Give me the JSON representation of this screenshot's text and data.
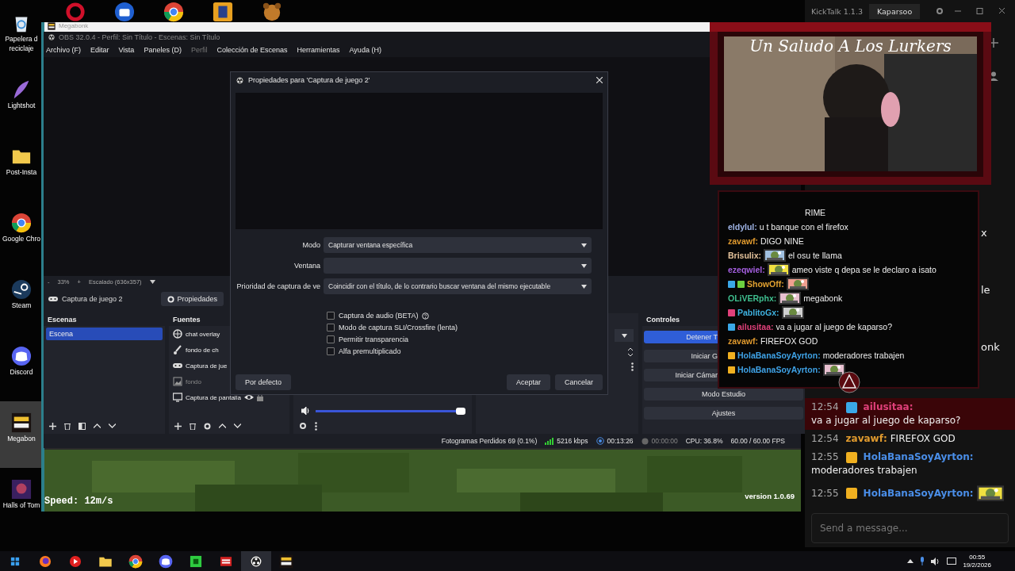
{
  "desktop": {
    "top_icons": [
      {
        "kind": "ring"
      },
      {
        "kind": "camera"
      },
      {
        "kind": "browser"
      },
      {
        "kind": "game"
      },
      {
        "kind": "bear"
      }
    ],
    "icons": [
      {
        "kind": "recycle",
        "lines": [
          "Papelera d",
          "reciclaje"
        ],
        "selected": false
      },
      {
        "kind": "feather",
        "lines": [
          "Lightshot"
        ],
        "selected": false
      },
      {
        "kind": "folder",
        "lines": [
          "Post-Insta"
        ],
        "selected": false
      },
      {
        "kind": "browser",
        "lines": [
          "Google Chro"
        ],
        "selected": false
      },
      {
        "kind": "steam",
        "lines": [
          "Steam"
        ],
        "selected": false
      },
      {
        "kind": "chat",
        "lines": [
          "Discord"
        ],
        "selected": false
      },
      {
        "kind": "megabonk",
        "lines": [
          "Megabon"
        ],
        "selected": true
      },
      {
        "kind": "halls",
        "lines": [
          "Halls of Tom"
        ],
        "selected": false
      }
    ]
  },
  "game_window": {
    "title": "Megabonk",
    "speed": "Speed: 12m/s",
    "version": "version 1.0.69"
  },
  "obs": {
    "title": "OBS 32.0.4 - Perfil: Sin Título - Escenas: Sin Título",
    "menu": [
      {
        "label": "Archivo (F)",
        "disabled": false
      },
      {
        "label": "Editar",
        "disabled": false
      },
      {
        "label": "Vista",
        "disabled": false
      },
      {
        "label": "Paneles (D)",
        "disabled": false
      },
      {
        "label": "Perfil",
        "disabled": true
      },
      {
        "label": "Colección de Escenas",
        "disabled": false
      },
      {
        "label": "Herramientas",
        "disabled": false
      },
      {
        "label": "Ayuda (H)",
        "disabled": false
      }
    ],
    "zoom": {
      "minus": "-",
      "percent": "33%",
      "plus": "+",
      "scale": "Escalado (636x357)"
    },
    "source_bar": {
      "source": "Captura de juego 2",
      "properties": "Propiedades"
    },
    "scenes": {
      "title": "Escenas",
      "items": [
        {
          "label": "Escena",
          "selected": true
        }
      ]
    },
    "sources": {
      "title": "Fuentes",
      "items": [
        {
          "kind": "browser",
          "label": "chat overlay",
          "visible": true,
          "hovered": false
        },
        {
          "kind": "brush",
          "label": "fondo de ch",
          "visible": true,
          "hovered": false
        },
        {
          "kind": "game",
          "label": "Captura de jue",
          "visible": true,
          "hovered": false
        },
        {
          "label": "fondo",
          "visible": false,
          "hovered": false
        },
        {
          "kind": "display",
          "label": "Captura de pantalla",
          "visible": true,
          "hovered": true
        }
      ]
    },
    "mixer": {
      "level": 1
    },
    "controls": {
      "title": "Controles",
      "buttons": [
        {
          "label": "Detener T",
          "kind": "cut",
          "active": true
        },
        {
          "label": "Iniciar G",
          "kind": "cut",
          "active": false
        },
        {
          "label": "Iniciar Cámar",
          "kind": "cut",
          "active": false
        },
        {
          "label": "Modo Estudio",
          "kind": "full",
          "active": false
        },
        {
          "label": "Ajustes",
          "kind": "full",
          "active": false
        }
      ]
    },
    "status": {
      "dropped": "Fotogramas Perdidos 69 (0.1%)",
      "bitrate": "5216 kbps",
      "stream_time": "00:13:26",
      "rec_time": "00:00:00",
      "cpu": "CPU: 36.8%",
      "fps": "60.00 / 60.00 FPS"
    }
  },
  "dialog": {
    "title": "Propiedades para 'Captura de juego 2'",
    "fields": [
      {
        "label": "Modo",
        "value": "Capturar ventana específica"
      },
      {
        "label": "Ventana"
      },
      {
        "label": "Prioridad de captura de ve",
        "value": "Coincidir con el título, de lo contrario buscar ventana del mismo ejecutable"
      }
    ],
    "checks": [
      {
        "label": "Captura de audio (BETA)",
        "checked": false,
        "help": true
      },
      {
        "label": "Modo de captura SLI/Crossfire (lenta)",
        "checked": false,
        "help": false
      },
      {
        "label": "Permitir transparencia",
        "checked": false,
        "help": false
      },
      {
        "label": "Alfa premultiplicado",
        "checked": false,
        "help": false
      }
    ],
    "defaults": "Por defecto",
    "ok": "Aceptar",
    "cancel": "Cancelar"
  },
  "webcam": {
    "caption": "Un Saludo A Los Lurkers"
  },
  "chat_overlay": {
    "messages": [
      {
        "text": "RIME"
      },
      {
        "user": "eldylul:",
        "color": "#9fb4e6",
        "text": "u t banque con el firefox",
        "emote": false
      },
      {
        "user": "zavawf:",
        "color": "#e09a2e",
        "text": "DIGO NINE",
        "emote": false
      },
      {
        "user": "Brisulix:",
        "color": "#e6c49c",
        "text": "el osu te llama",
        "emote": true
      },
      {
        "user": "ezeqwiel:",
        "color": "#a55fe0",
        "text": "ameo viste q depa se le declaro a isato",
        "emote": true
      },
      {
        "user": "ShowOff:",
        "color": "#e0a030",
        "badges": [
          {
            "kind": "mod"
          },
          {
            "kind": "green"
          }
        ],
        "emote": true
      },
      {
        "user": "OLiVERphx:",
        "color": "#3fbf8f",
        "text": "megabonk",
        "emote": true
      },
      {
        "user": "PablitoGx:",
        "color": "#3fb2e0",
        "badges": [
          {
            "kind": "pink"
          }
        ],
        "emote": true
      },
      {
        "user": "ailusitaa:",
        "color": "#e0407a",
        "text": "va a jugar al juego de kaparso?",
        "badges": [
          {
            "kind": "mod"
          }
        ],
        "emote": false
      },
      {
        "user": "zavawf:",
        "color": "#e09a2e",
        "text": "FIREFOX GOD",
        "emote": false
      },
      {
        "user": "HolaBanaSoyAyrton:",
        "color": "#3fa2e6",
        "text": "moderadores trabajen",
        "badges": [
          {
            "kind": "gold"
          }
        ],
        "emote": false
      },
      {
        "user": "HolaBanaSoyAyrton:",
        "color": "#3fa2e6",
        "badges": [
          {
            "kind": "gold"
          }
        ],
        "emote": true
      }
    ]
  },
  "kicktalk": {
    "title": "KickTalk 1.1.3",
    "tab": "Kaparsoo",
    "fragments": [
      "x",
      "le",
      "onk"
    ],
    "messages": [
      {
        "time": "12:54",
        "badges": [
          {
            "kind": "mod"
          }
        ],
        "user": "ailusitaa:",
        "color": "#e0407a",
        "text": "va a jugar al juego de kaparso?",
        "highlighted": true,
        "emote": false
      },
      {
        "time": "12:54",
        "user": "zavawf:",
        "color": "#e09a2e",
        "text": "FIREFOX GOD",
        "highlighted": false,
        "emote": false
      },
      {
        "time": "12:55",
        "badges": [
          {
            "kind": "gold"
          }
        ],
        "user": "HolaBanaSoyAyrton:",
        "color": "#4a8ee8",
        "text": "moderadores trabajen",
        "highlighted": false,
        "emote": false
      },
      {
        "time": "12:55",
        "badges": [
          {
            "kind": "gold"
          }
        ],
        "user": "HolaBanaSoyAyrton:",
        "color": "#4a8ee8",
        "highlighted": false,
        "emote": true
      }
    ],
    "placeholder": "Send a message..."
  },
  "taskbar": {
    "apps": [
      {
        "kind": "start",
        "selected": false
      },
      {
        "kind": "fox",
        "selected": false
      },
      {
        "kind": "play",
        "selected": false
      },
      {
        "kind": "folder",
        "selected": false
      },
      {
        "kind": "browser",
        "selected": false
      },
      {
        "kind": "chat",
        "selected": false
      },
      {
        "kind": "green",
        "selected": false
      },
      {
        "kind": "mixer",
        "selected": false
      },
      {
        "kind": "obs",
        "selected": true
      },
      {
        "kind": "megabonk",
        "selected": false
      }
    ],
    "time": "00:55",
    "date": "19/2/2026"
  }
}
